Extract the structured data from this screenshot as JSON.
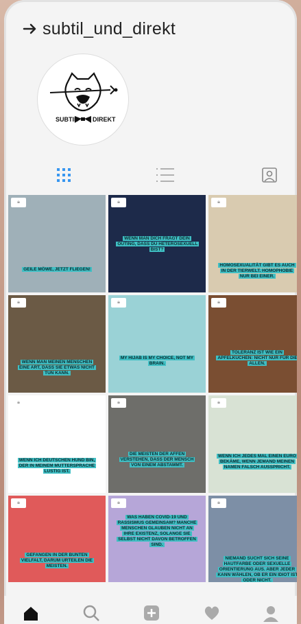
{
  "profile": {
    "username": "subtil_und_direkt",
    "logo_text_left": "SUBTIL",
    "logo_text_right": "DIREKT"
  },
  "tabs": [
    {
      "name": "grid",
      "icon": "grid-icon",
      "active": true
    },
    {
      "name": "list",
      "icon": "list-icon",
      "active": false
    },
    {
      "name": "tagged",
      "icon": "tagged-person-icon",
      "active": false
    }
  ],
  "posts": [
    {
      "caption": "GEILE MÖWE, JETZT FLIEGEN!",
      "bg": "#9fb0b8"
    },
    {
      "caption": "WENN MAN DICH FRAGT DEIN OUTING, DASS DU HETEROSEXUELL BIST?",
      "bg": "#1d2a4a"
    },
    {
      "caption": "HOMOSEXUALITÄT GIBT ES AUCH IN DER TIERWELT. HOMOPHOBIE NUR BEI EINER.",
      "bg": "#d9cbb0"
    },
    {
      "caption": "WENN MAN MEINEN MENSCHEN EINE ART, DASS SIE ETWAS NICHT TUN KANN.",
      "bg": "#6b5a45"
    },
    {
      "caption": "MY HIJAB IS MY CHOICE, NOT MY BRAIN.",
      "bg": "#9ad2d6"
    },
    {
      "caption": "TOLERANZ IST WIE EIN APFELKUCHEN: NICHT NUR FÜR DIE ALLEN.",
      "bg": "#7a4e32"
    },
    {
      "caption": "WENN ICH DEUTSCHEN HUND BIN, DER IN MEINEM MUTTERSPRACHE LUSTIG IST.",
      "bg": "#ffffff"
    },
    {
      "caption": "DIE MEISTEN DER AFFEN VERSTEHEN, DASS DER MENSCH VON EINEM ABSTAMMT.",
      "bg": "#6e6e6a"
    },
    {
      "caption": "WENN ICH JEDES MAL EINEN EURO BEKÄME, WENN JEMAND MEINEN NAMEN FALSCH AUSSPRICHT.",
      "bg": "#d8e2d4"
    },
    {
      "caption": "GEFANGEN IN DER BUNTEN VIELFALT, DARUM URTEILEN DIE MEISTEN.",
      "bg": "#e05a5a"
    },
    {
      "caption": "WAS HABEN COVID-19 UND RASSISMUS GEMEINSAM? MANCHE MENSCHEN GLAUBEN NICHT AN IHRE EXISTENZ, SOLANGE SIE SELBST NICHT DAVON BETROFFEN SIND.",
      "bg": "#b6a6d8"
    },
    {
      "caption": "NIEMAND SUCHT SICH SEINE HAUTFARBE ODER SEXUELLE ORIENTIERUNG AUS. ABER JEDER KANN WÄHLEN, OB ER EIN IDIOT IST ODER NICHT.",
      "bg": "#7d8fa6"
    }
  ],
  "bottom_nav": [
    {
      "name": "home",
      "icon": "home-icon"
    },
    {
      "name": "search",
      "icon": "search-icon"
    },
    {
      "name": "add",
      "icon": "add-post-icon"
    },
    {
      "name": "activity",
      "icon": "heart-icon"
    },
    {
      "name": "profile",
      "icon": "profile-icon"
    }
  ],
  "colors": {
    "accent_blue": "#3897f0",
    "caption_bg": "#3fbfc4",
    "icon_gray": "#999999"
  }
}
